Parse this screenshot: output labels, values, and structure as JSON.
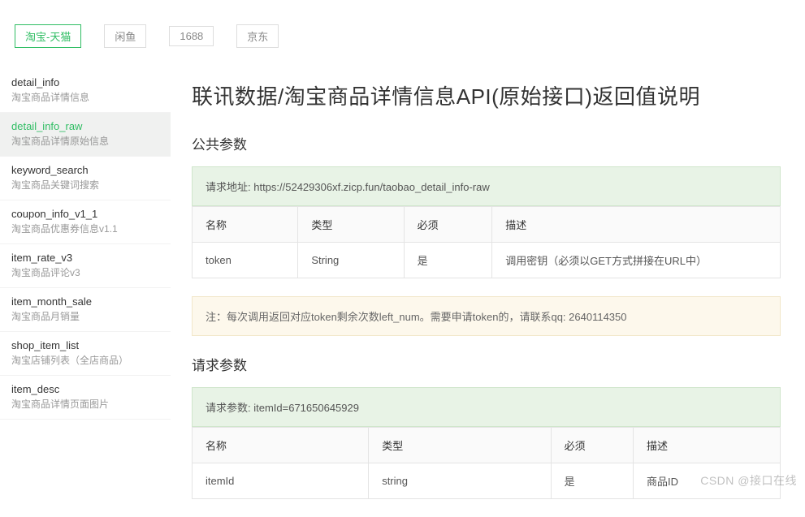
{
  "tabs": [
    {
      "label": "淘宝-天猫",
      "active": true
    },
    {
      "label": "闲鱼"
    },
    {
      "label": "1688"
    },
    {
      "label": "京东"
    }
  ],
  "sidebar": [
    {
      "title": "detail_info",
      "sub": "淘宝商品详情信息"
    },
    {
      "title": "detail_info_raw",
      "sub": "淘宝商品详情原始信息",
      "active": true
    },
    {
      "title": "keyword_search",
      "sub": "淘宝商品关键词搜索"
    },
    {
      "title": "coupon_info_v1_1",
      "sub": "淘宝商品优惠券信息v1.1"
    },
    {
      "title": "item_rate_v3",
      "sub": "淘宝商品评论v3"
    },
    {
      "title": "item_month_sale",
      "sub": "淘宝商品月销量"
    },
    {
      "title": "shop_item_list",
      "sub": "淘宝店铺列表（全店商品）"
    },
    {
      "title": "item_desc",
      "sub": "淘宝商品详情页面图片"
    }
  ],
  "page_title": "联讯数据/淘宝商品详情信息API(原始接口)返回值说明",
  "section_public": "公共参数",
  "request_url": "请求地址: https://52429306xf.zicp.fun/taobao_detail_info-raw",
  "public_headers": {
    "name": "名称",
    "type": "类型",
    "required": "必须",
    "desc": "描述"
  },
  "public_rows": [
    {
      "name": "token",
      "type": "String",
      "required": "是",
      "desc": "调用密钥（必须以GET方式拼接在URL中）"
    }
  ],
  "note": "注：每次调用返回对应token剩余次数left_num。需要申请token的，请联系qq: 2640114350",
  "section_req": "请求参数",
  "req_params_box": "请求参数: itemId=671650645929",
  "req_headers": {
    "name": "名称",
    "type": "类型",
    "required": "必须",
    "desc": "描述"
  },
  "req_rows": [
    {
      "name": "itemId",
      "type": "string",
      "required": "是",
      "desc": "商品ID"
    }
  ],
  "watermark": "CSDN @接口在线"
}
